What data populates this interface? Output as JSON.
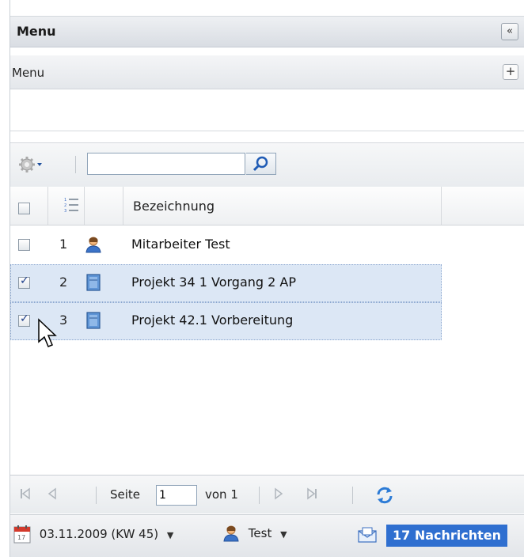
{
  "header": {
    "title": "Menu",
    "collapse_glyph": "«"
  },
  "subpanel": {
    "title": "Menu",
    "add_glyph": "+"
  },
  "toolbar": {
    "search_value": "",
    "search_placeholder": ""
  },
  "grid": {
    "column_header": "Bezeichnung",
    "rows": [
      {
        "number": "1",
        "icon": "person-icon",
        "label": "Mitarbeiter Test",
        "checked": false,
        "selected": false
      },
      {
        "number": "2",
        "icon": "book-icon",
        "label": "Projekt 34 1 Vorgang 2 AP",
        "checked": true,
        "selected": true
      },
      {
        "number": "3",
        "icon": "book-icon",
        "label": "Projekt 42.1 Vorbereitung",
        "checked": true,
        "selected": true
      }
    ]
  },
  "pager": {
    "page_label": "Seite",
    "page_value": "1",
    "of_label": "von 1"
  },
  "status_bar": {
    "date": "03.11.2009 (KW 45)",
    "user": "Test",
    "messages": "17 Nachrichten"
  },
  "colors": {
    "selection": "#dce7f5",
    "accent": "#2f6fd0"
  }
}
